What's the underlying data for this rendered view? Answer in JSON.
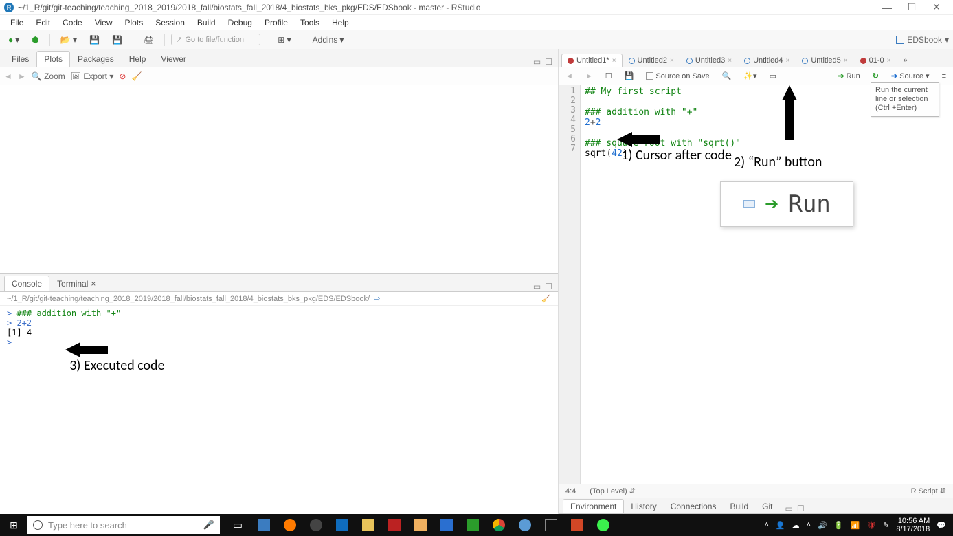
{
  "titlebar": {
    "title": "~/1_R/git/git-teaching/teaching_2018_2019/2018_fall/biostats_fall_2018/4_biostats_bks_pkg/EDS/EDSbook - master - RStudio"
  },
  "menubar": [
    "File",
    "Edit",
    "Code",
    "View",
    "Plots",
    "Session",
    "Build",
    "Debug",
    "Profile",
    "Tools",
    "Help"
  ],
  "toolbar": {
    "goto_placeholder": "Go to file/function",
    "addins": "Addins",
    "project": "EDSbook"
  },
  "plots_pane": {
    "tabs": [
      "Files",
      "Plots",
      "Packages",
      "Help",
      "Viewer"
    ],
    "active": "Plots",
    "tool": {
      "zoom": "Zoom",
      "export": "Export"
    }
  },
  "console_pane": {
    "tabs": [
      "Console",
      "Terminal"
    ],
    "active": "Console",
    "path": "~/1_R/git/git-teaching/teaching_2018_2019/2018_fall/biostats_fall_2018/4_biostats_bks_pkg/EDS/EDSbook/",
    "lines": [
      {
        "t": "prompt",
        "v": "> "
      },
      {
        "t": "cmt",
        "v": "### addition with \"+\""
      },
      {
        "t": "br"
      },
      {
        "t": "prompt",
        "v": "> "
      },
      {
        "t": "num",
        "v": "2+2"
      },
      {
        "t": "br"
      },
      {
        "t": "out",
        "v": "[1] 4"
      },
      {
        "t": "br"
      },
      {
        "t": "prompt",
        "v": "> "
      }
    ]
  },
  "source_pane": {
    "tabs": [
      {
        "label": "Untitled1*",
        "active": true,
        "red": true
      },
      {
        "label": "Untitled2"
      },
      {
        "label": "Untitled3"
      },
      {
        "label": "Untitled4"
      },
      {
        "label": "Untitled5"
      },
      {
        "label": "01-0",
        "red": true
      }
    ],
    "more": "»",
    "tool": {
      "source_on_save": "Source on Save",
      "run": "Run",
      "source": "Source"
    },
    "code": [
      {
        "n": 1,
        "seg": [
          {
            "c": "com",
            "v": "## My first script"
          }
        ]
      },
      {
        "n": 2,
        "seg": []
      },
      {
        "n": 3,
        "seg": [
          {
            "c": "com",
            "v": "### addition with \"+\""
          }
        ]
      },
      {
        "n": 4,
        "seg": [
          {
            "c": "num",
            "v": "2"
          },
          {
            "c": "pr",
            "v": "+"
          },
          {
            "c": "num",
            "v": "2"
          }
        ],
        "cursor": true
      },
      {
        "n": 5,
        "seg": []
      },
      {
        "n": 6,
        "seg": [
          {
            "c": "com",
            "v": "### square root with \"sqrt()\""
          }
        ]
      },
      {
        "n": 7,
        "seg": [
          {
            "c": "fn",
            "v": "sqrt"
          },
          {
            "c": "pr",
            "v": "("
          },
          {
            "c": "num",
            "v": "42"
          },
          {
            "c": "pr",
            "v": ")"
          }
        ]
      }
    ],
    "status": {
      "pos": "4:4",
      "scope": "(Top Level)",
      "type": "R Script"
    }
  },
  "env_pane": {
    "tabs": [
      "Environment",
      "History",
      "Connections",
      "Build",
      "Git"
    ],
    "active": "Environment"
  },
  "tooltip": "Run the current line or selection (Ctrl +Enter)",
  "annotations": {
    "a1": "1) Cursor after code",
    "a2": "2) “Run” button",
    "a3": "3) Executed code",
    "run_inset": "Run"
  },
  "taskbar": {
    "search_placeholder": "Type here to search",
    "time": "10:56 AM",
    "date": "8/17/2018"
  }
}
